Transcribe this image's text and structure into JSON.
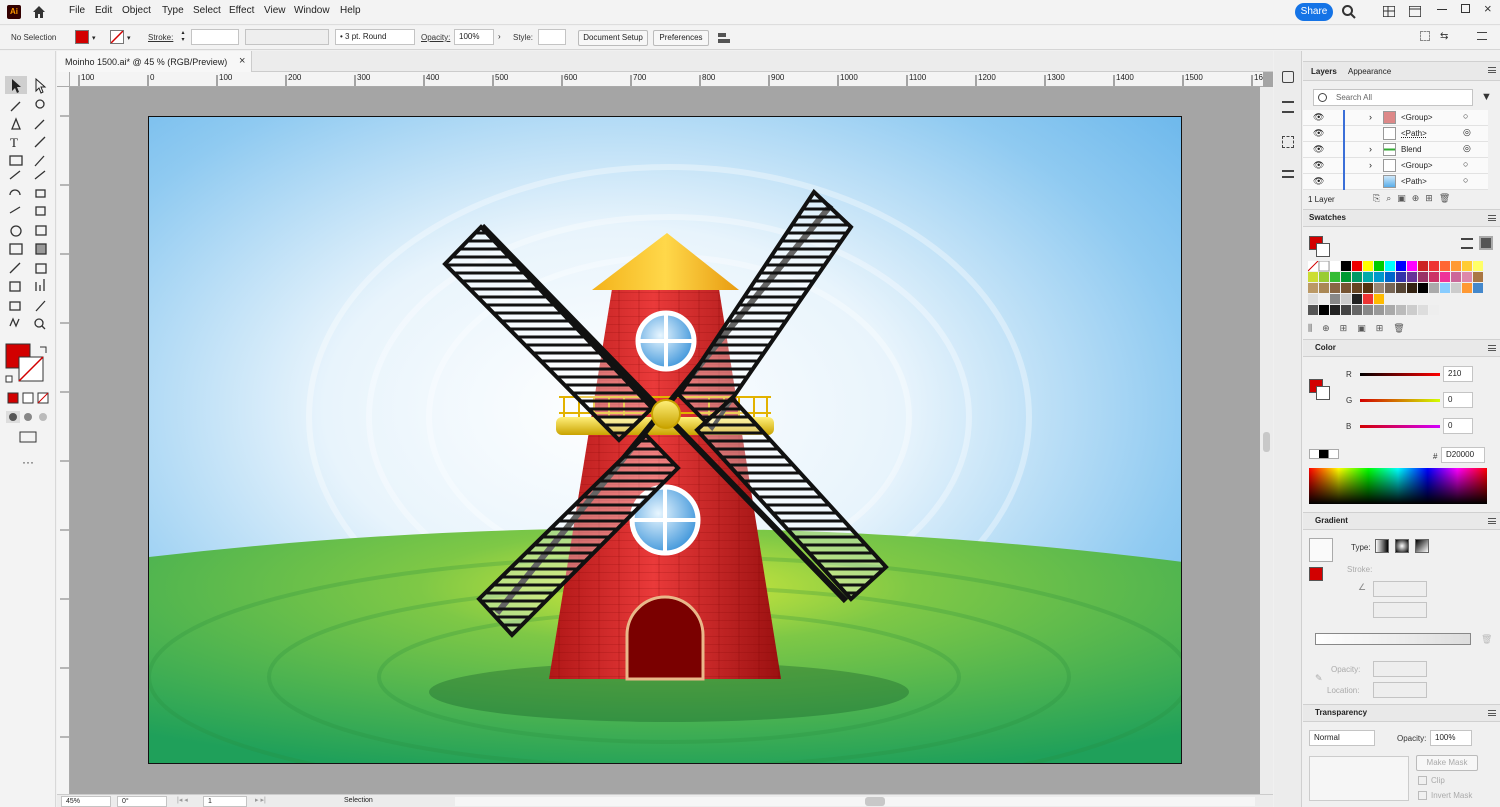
{
  "app": {
    "logo": "Ai"
  },
  "menu": [
    "File",
    "Edit",
    "Object",
    "Type",
    "Select",
    "Effect",
    "View",
    "Window",
    "Help"
  ],
  "topright": {
    "share": "Share"
  },
  "control": {
    "selection": "No Selection",
    "stroke_label": "Stroke:",
    "brush": "3 pt. Round",
    "opacity_label": "Opacity:",
    "opacity": "100%",
    "style_label": "Style:",
    "doc_setup": "Document Setup",
    "preferences": "Preferences"
  },
  "tab": {
    "title": "Moinho 1500.ai* @ 45 % (RGB/Preview)",
    "close": "×"
  },
  "ruler": {
    "h": [
      "100",
      "0",
      "100",
      "200",
      "300",
      "400",
      "500",
      "600",
      "700",
      "800",
      "900",
      "1000",
      "1100",
      "1200",
      "1300",
      "1400",
      "1500",
      "16"
    ]
  },
  "status": {
    "zoom": "45%",
    "rotation": "0°",
    "artboard": "1",
    "tool": "Selection"
  },
  "layers": {
    "tab": "Layers",
    "tab2": "Appearance",
    "search": "Search All",
    "rows": [
      "<Group>",
      "<Path>",
      "Blend",
      "<Group>",
      "<Path>"
    ],
    "footer": "1 Layer"
  },
  "swatches": {
    "title": "Swatches"
  },
  "color": {
    "title": "Color",
    "r_label": "R",
    "g_label": "G",
    "b_label": "B",
    "r": "210",
    "g": "0",
    "b": "0",
    "hash": "#",
    "hex": "D20000"
  },
  "gradient": {
    "title": "Gradient",
    "type": "Type:",
    "stroke": "Stroke:",
    "opacity": "Opacity:",
    "location": "Location:"
  },
  "transparency": {
    "title": "Transparency",
    "mode": "Normal",
    "opacity_label": "Opacity:",
    "opacity": "100%",
    "make_mask": "Make Mask",
    "clip": "Clip",
    "invert": "Invert Mask"
  },
  "colors": {
    "accent": "#1473e6",
    "fill": "#d20000",
    "sky": "#5fb3ea",
    "grass": "#3bb04a",
    "tower": "#c41f1f"
  }
}
